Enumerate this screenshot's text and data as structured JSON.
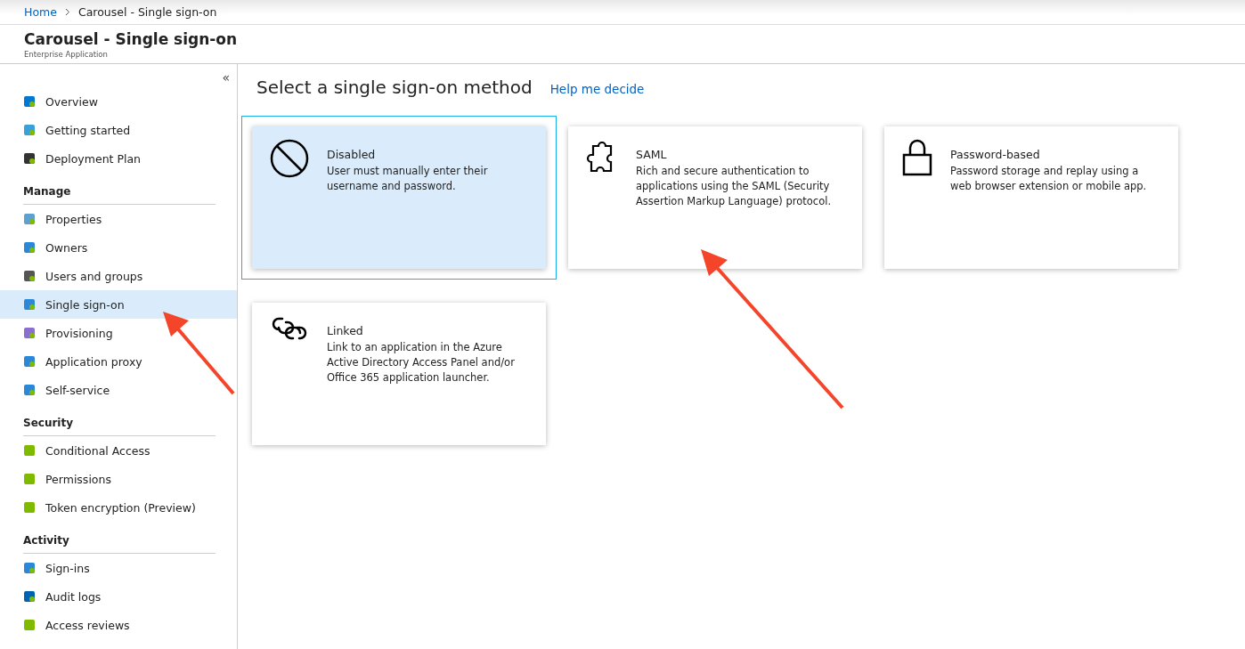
{
  "breadcrumb": [
    {
      "label": "Home",
      "link": true
    },
    {
      "label": "Carousel - Single sign-on",
      "link": false
    }
  ],
  "header": {
    "title": "Carousel - Single sign-on",
    "subtitle": "Enterprise Application"
  },
  "sidebar": {
    "collapse": "«",
    "sections": [
      {
        "items": [
          {
            "label": "Overview",
            "selected": false
          },
          {
            "label": "Getting started",
            "selected": false
          },
          {
            "label": "Deployment Plan",
            "selected": false
          }
        ]
      },
      {
        "heading": "Manage",
        "items": [
          {
            "label": "Properties",
            "selected": false
          },
          {
            "label": "Owners",
            "selected": false
          },
          {
            "label": "Users and groups",
            "selected": false
          },
          {
            "label": "Single sign-on",
            "selected": true
          },
          {
            "label": "Provisioning",
            "selected": false
          },
          {
            "label": "Application proxy",
            "selected": false
          },
          {
            "label": "Self-service",
            "selected": false
          }
        ]
      },
      {
        "heading": "Security",
        "items": [
          {
            "label": "Conditional Access",
            "selected": false
          },
          {
            "label": "Permissions",
            "selected": false
          },
          {
            "label": "Token encryption (Preview)",
            "selected": false
          }
        ]
      },
      {
        "heading": "Activity",
        "items": [
          {
            "label": "Sign-ins",
            "selected": false
          },
          {
            "label": "Audit logs",
            "selected": false
          },
          {
            "label": "Access reviews",
            "selected": false
          }
        ]
      }
    ]
  },
  "main": {
    "title": "Select a single sign-on method",
    "help_link": "Help me decide",
    "methods": [
      {
        "kind": "disabled",
        "title": "Disabled",
        "description": "User must manually enter their username and password.",
        "selected": true
      },
      {
        "kind": "saml",
        "title": "SAML",
        "description": "Rich and secure authentication to applications using the SAML (Security Assertion Markup Language) protocol.",
        "selected": false
      },
      {
        "kind": "password",
        "title": "Password-based",
        "description": "Password storage and replay using a web browser extension or mobile app.",
        "selected": false
      },
      {
        "kind": "linked",
        "title": "Linked",
        "description": "Link to an application in the Azure Active Directory Access Panel and/or Office 365 application launcher.",
        "selected": false
      }
    ]
  }
}
